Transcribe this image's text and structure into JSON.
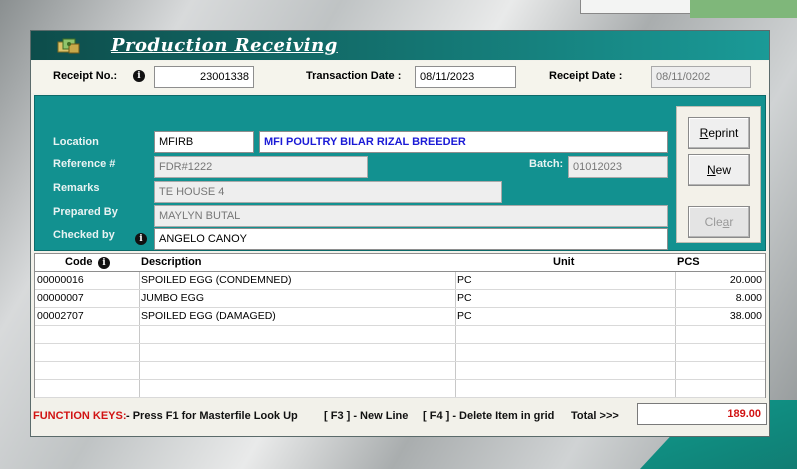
{
  "window": {
    "title": "Production Receiving"
  },
  "receipt": {
    "receipt_no_label": "Receipt No.:",
    "receipt_no": "23001338",
    "transaction_date_label": "Transaction Date :",
    "transaction_date": "08/11/2023",
    "receipt_date_label": "Receipt Date :",
    "receipt_date": "08/11/0202"
  },
  "form": {
    "location_label": "Location",
    "location_code": "MFIRB",
    "location_name": "MFI POULTRY BILAR RIZAL BREEDER",
    "reference_label": "Reference #",
    "reference": "FDR#1222",
    "batch_label": "Batch:",
    "batch": "01012023",
    "remarks_label": "Remarks",
    "remarks": "TE HOUSE 4",
    "prepared_by_label": "Prepared By",
    "prepared_by": "MAYLYN BUTAL",
    "checked_by_label": "Checked by",
    "checked_by": "ANGELO CANOY"
  },
  "buttons": {
    "reprint": "Reprint",
    "new": "New",
    "clear": "Clear"
  },
  "grid": {
    "columns": [
      "Code",
      "Description",
      "Unit",
      "PCS"
    ],
    "rows": [
      {
        "code": "00000016",
        "description": "SPOILED EGG (CONDEMNED)",
        "unit": "PC",
        "pcs": "20.000"
      },
      {
        "code": "00000007",
        "description": "JUMBO EGG",
        "unit": "PC",
        "pcs": "8.000"
      },
      {
        "code": "00002707",
        "description": "SPOILED EGG (DAMAGED)",
        "unit": "PC",
        "pcs": "38.000"
      }
    ]
  },
  "footer": {
    "function_keys_label": "FUNCTION KEYS:",
    "hint_f1": "- Press F1 for Masterfile Look Up",
    "hint_f3": "[ F3 ] - New Line",
    "hint_f4": "[ F4 ] - Delete Item in grid",
    "total_label": "Total >>>",
    "total_value": "189.00"
  },
  "colors": {
    "panel_teal": "#129190",
    "title_dark": "#0d4d4b",
    "accent_red": "#d11313",
    "location_blue": "#1a1ad6"
  },
  "icons": [
    "money-icon",
    "info-icon"
  ]
}
